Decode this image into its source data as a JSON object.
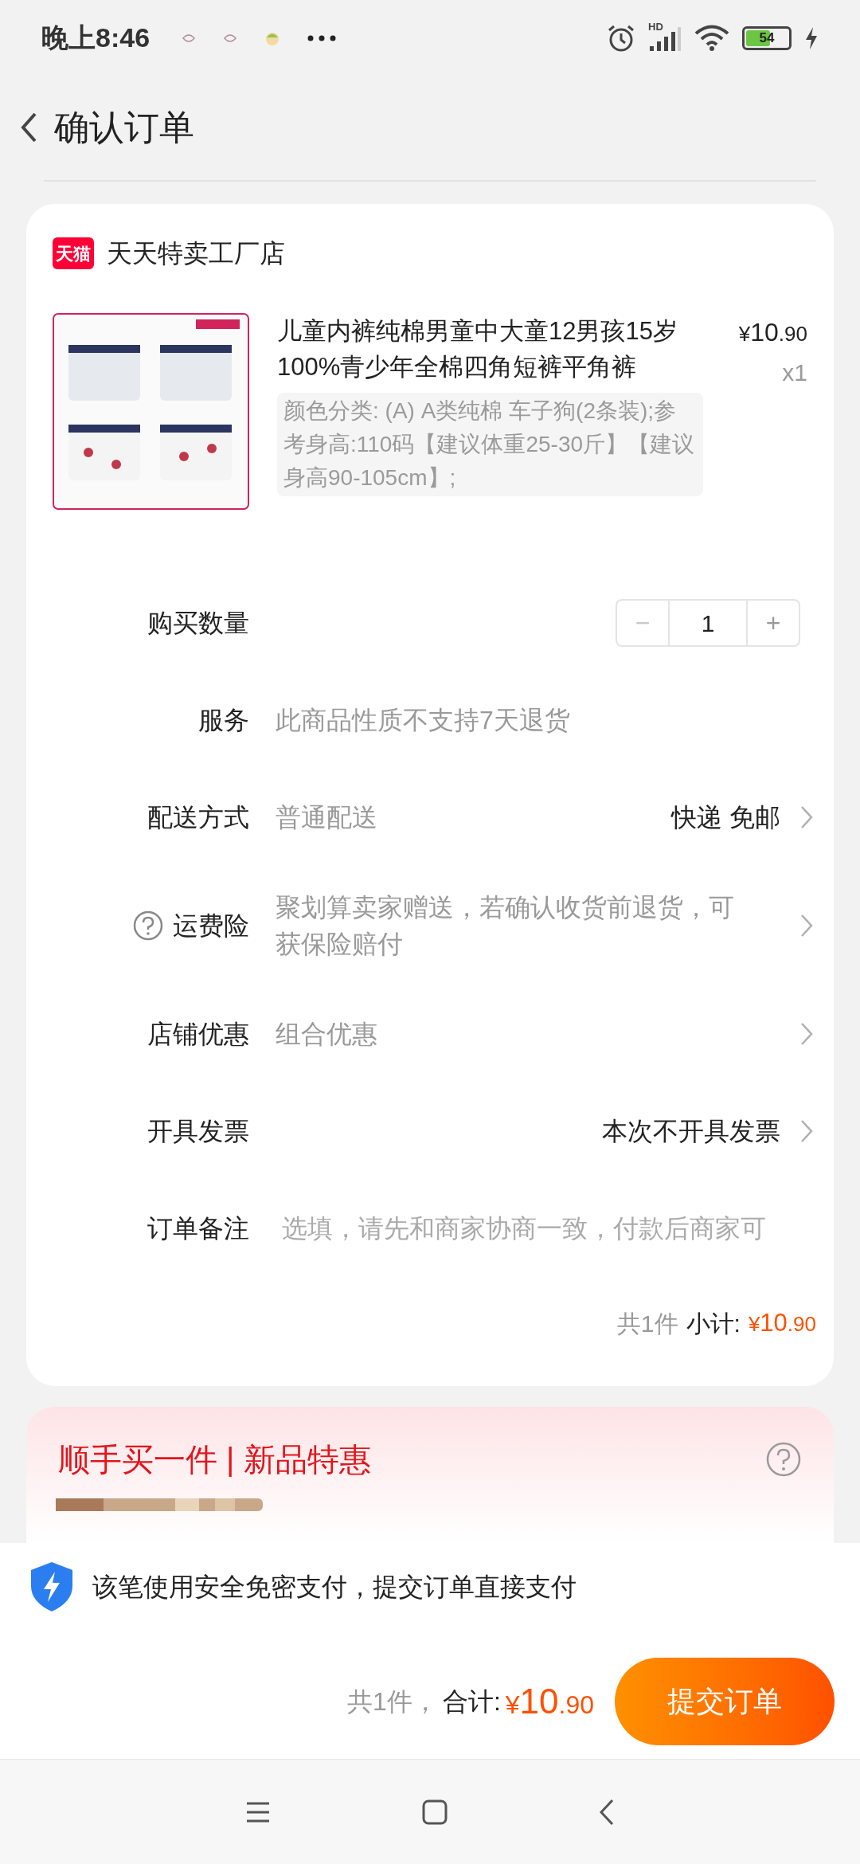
{
  "status_bar": {
    "time": "晚上8:46",
    "network": "HD",
    "battery": "54"
  },
  "header": {
    "title": "确认订单"
  },
  "shop": {
    "logo_text": "天猫",
    "name": "天天特卖工厂店"
  },
  "product": {
    "title": "儿童内裤纯棉男童中大童12男孩15岁100%青少年全棉四角短裤平角裤",
    "currency": "¥",
    "price_integer": "10",
    "price_decimal": ".90",
    "quantity": "x1",
    "spec": "颜色分类: (A) A类纯棉 车子狗(2条装);参考身高:110码【建议体重25-30斤】【建议身高90-105cm】;"
  },
  "rows": [
    {
      "kind": "stepper",
      "label": "购买数量",
      "minus": "−",
      "value": "1",
      "plus": "+"
    },
    {
      "kind": "text",
      "label": "服务",
      "value": "此商品性质不支持7天退货"
    },
    {
      "kind": "link",
      "label": "配送方式",
      "value": "普通配送",
      "right": "快递 免邮"
    },
    {
      "kind": "link",
      "label": "运费险",
      "help": true,
      "value": "聚划算卖家赠送，若确认收货前退货，可获保险赔付"
    },
    {
      "kind": "link",
      "label": "店铺优惠",
      "value": "组合优惠"
    },
    {
      "kind": "link",
      "label": "开具发票",
      "right": "本次不开具发票"
    },
    {
      "kind": "input",
      "label": "订单备注",
      "placeholder": "选填，请先和商家协商一致，付款后商家可"
    }
  ],
  "subtotal": {
    "count": "共1件",
    "label": "小计:",
    "currency": "¥",
    "price_integer": "10",
    "price_decimal": ".90"
  },
  "upsell": {
    "title": "顺手买一件 | 新品特惠"
  },
  "payment_notice": "该笔使用安全免密支付，提交订单直接支付",
  "footer": {
    "count": "共1件，",
    "label": "合计:",
    "currency": "¥",
    "price_integer": "10",
    "price_decimal": ".90",
    "submit": "提交订单"
  }
}
